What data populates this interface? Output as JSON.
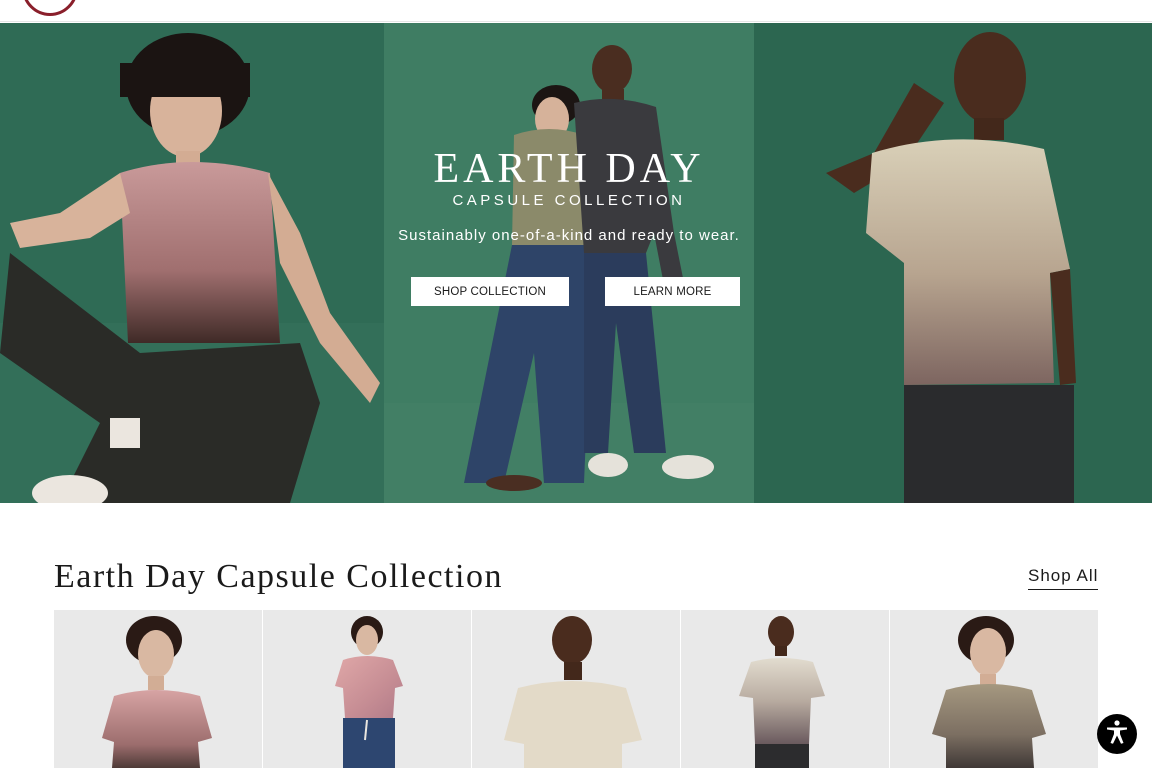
{
  "hero": {
    "title": "EARTH DAY",
    "subtitle": "CAPSULE COLLECTION",
    "tagline": "Sustainably one-of-a-kind and ready to wear.",
    "shop_button": "SHOP COLLECTION",
    "learn_button": "LEARN MORE"
  },
  "section": {
    "title": "Earth Day Capsule Collection",
    "shop_all": "Shop All"
  },
  "products": [
    {
      "image": "woman-pink-tie-dye-tee"
    },
    {
      "image": "woman-pink-tie-dye-crop-tee-jeans"
    },
    {
      "image": "man-cream-tee"
    },
    {
      "image": "man-cream-grey-dip-dye-tee"
    },
    {
      "image": "woman-olive-dip-dye-tee"
    }
  ],
  "colors": {
    "brand": "#8a1f2b",
    "hero_green": "#3f7d63",
    "button_bg": "#ffffff"
  },
  "icons": [
    "accessibility-icon"
  ]
}
